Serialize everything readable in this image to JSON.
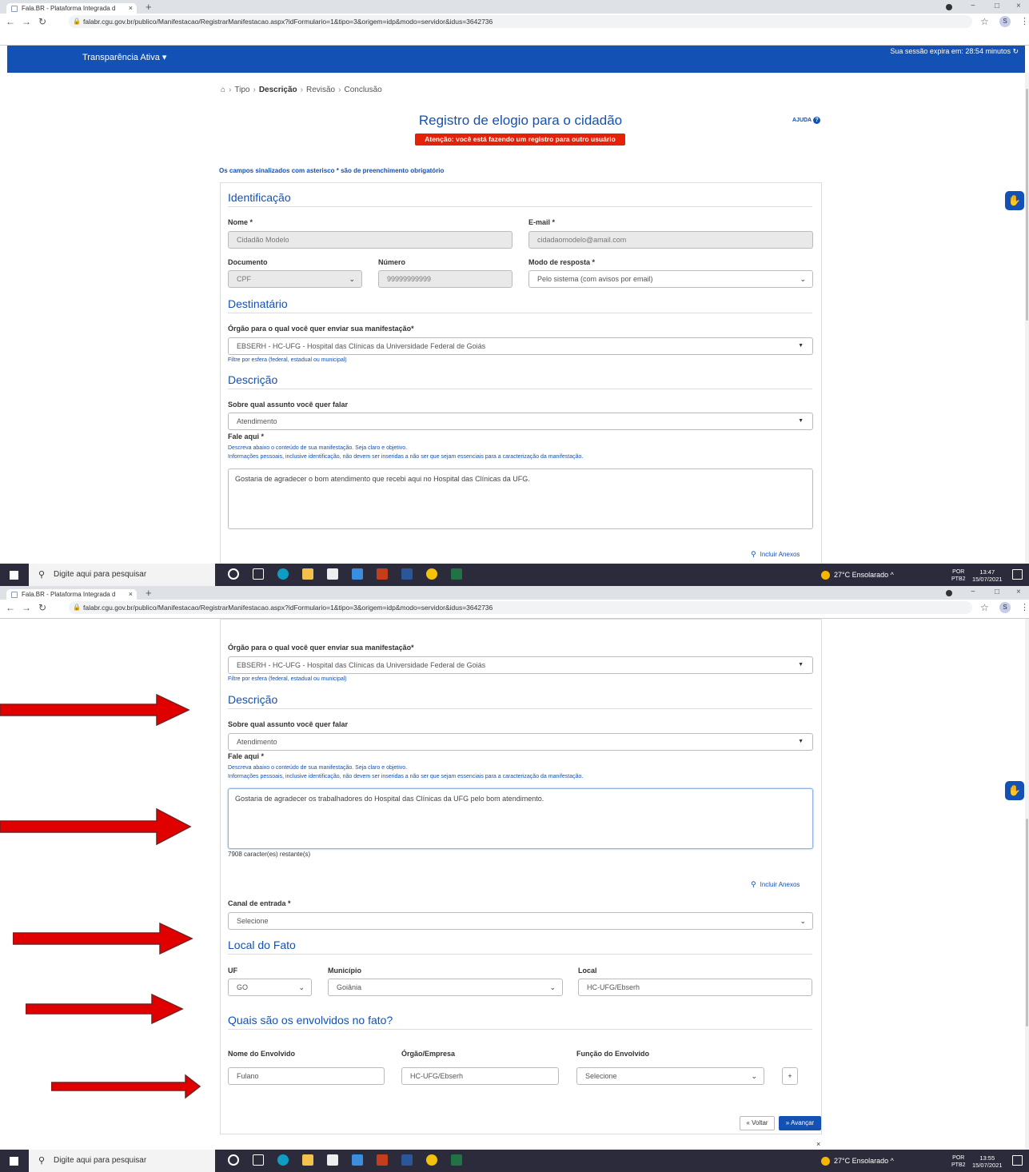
{
  "browser": {
    "tab_title": "Fala.BR - Plataforma Integrada d",
    "tab_close": "×",
    "new_tab": "+",
    "url": "falabr.cgu.gov.br/publico/Manifestacao/RegistrarManifestacao.aspx?idFormulario=1&tipo=3&origem=idp&modo=servidor&idus=3642736",
    "profile_initial": "S",
    "win_min": "−",
    "win_max": "□",
    "win_close": "×"
  },
  "header": {
    "menu": "Transparência Ativa ▾",
    "session": "Sua sessão expira em: 28:54 minutos ↻"
  },
  "breadcrumb": {
    "step1": "Tipo",
    "step2": "Descrição",
    "step3": "Revisão",
    "step4": "Conclusão"
  },
  "page": {
    "title": "Registro de elogio para o cidadão",
    "ajuda": "AJUDA",
    "warning": "Atenção: você está fazendo um registro para outro usuário",
    "required_note": "Os campos sinalizados com asterisco * são de preenchimento obrigatório"
  },
  "identificacao": {
    "heading": "Identificação",
    "nome_label": "Nome *",
    "nome_value": "Cidadão Modelo",
    "email_label": "E-mail *",
    "email_value": "cidadaomodelo@amail.com",
    "documento_label": "Documento",
    "documento_value": "CPF",
    "numero_label": "Número",
    "numero_value": "99999999999",
    "modo_label": "Modo de resposta *",
    "modo_value": "Pelo sistema (com avisos por email)"
  },
  "destinatario": {
    "heading": "Destinatário",
    "orgao_label": "Órgão para o qual você quer enviar sua manifestação*",
    "orgao_value": "EBSERH - HC-UFG - Hospital das Clínicas da Universidade Federal de Goiás",
    "filtro_link": "Filtre por esfera (federal, estadual ou municipal)"
  },
  "descricao": {
    "heading": "Descrição",
    "assunto_label": "Sobre qual assunto você quer falar",
    "assunto_value": "Atendimento",
    "fale_label": "Fale aqui *",
    "help1": "Descreva abaixo o conteúdo de sua manifestação. Seja claro e objetivo.",
    "help2": "Informações pessoais, inclusive identificação, não devem ser inseridas a não ser que sejam essenciais para a caracterização da manifestação.",
    "text_before": "Gostaria de agradecer  o bom atendimento que recebi aqui no Hospital das Clínicas da UFG.",
    "text_after": "Gostaria de agradecer os trabalhadores do Hospital das Clínicas da UFG pelo bom atendimento.",
    "counter": "7908 caracter(es) restante(s)",
    "anexos": "Incluir Anexos"
  },
  "canal": {
    "label": "Canal de entrada *",
    "value": "Selecione"
  },
  "local": {
    "heading": "Local do Fato",
    "uf_label": "UF",
    "uf_value": "GO",
    "municipio_label": "Município",
    "municipio_value": "Goiânia",
    "local_label": "Local",
    "local_value": "HC-UFG/Ebserh"
  },
  "envolvidos": {
    "heading": "Quais são os envolvidos no fato?",
    "nome_label": "Nome do Envolvido",
    "nome_value": "Fulano",
    "orgao_label": "Órgão/Empresa",
    "orgao_value": "HC-UFG/Ebserh",
    "funcao_label": "Função do Envolvido",
    "funcao_value": "Selecione",
    "add": "+"
  },
  "actions": {
    "voltar": "« Voltar",
    "avancar": "» Avançar",
    "close": "×"
  },
  "taskbar": {
    "search_placeholder": "Digite aqui para pesquisar",
    "weather": "27°C  Ensolarado   ^",
    "lang1": "POR",
    "lang2": "PTB2",
    "time1": "13:47",
    "time2": "13:55",
    "date": "15/07/2021"
  },
  "colors": {
    "brand": "#1351b4",
    "warning": "#e52207",
    "arrow": "#e00000"
  }
}
